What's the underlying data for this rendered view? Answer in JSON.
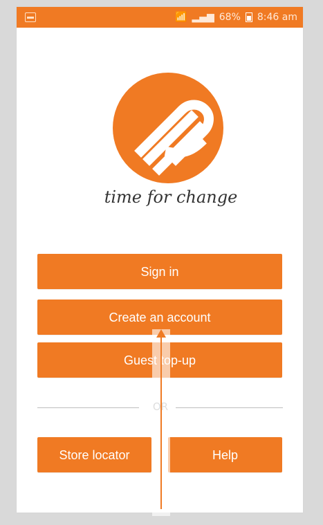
{
  "status": {
    "battery_text": "68%",
    "time": "8:46 am"
  },
  "brand": {
    "tagline": "time for change"
  },
  "buttons": {
    "sign_in": "Sign in",
    "create_account": "Create an account",
    "guest_topup": "Guest top-up",
    "store_locator": "Store locator",
    "help": "Help"
  },
  "divider": {
    "label": "OR"
  },
  "colors": {
    "accent": "#f07a23",
    "background": "#d9d9d9",
    "panel": "#ffffff",
    "text": "#333333"
  },
  "icons": {
    "status_app": "image-icon",
    "wifi": "wifi-icon",
    "signal": "signal-icon",
    "battery": "battery-icon",
    "logo": "brand-logo-icon",
    "arrow": "up-arrow-icon"
  }
}
